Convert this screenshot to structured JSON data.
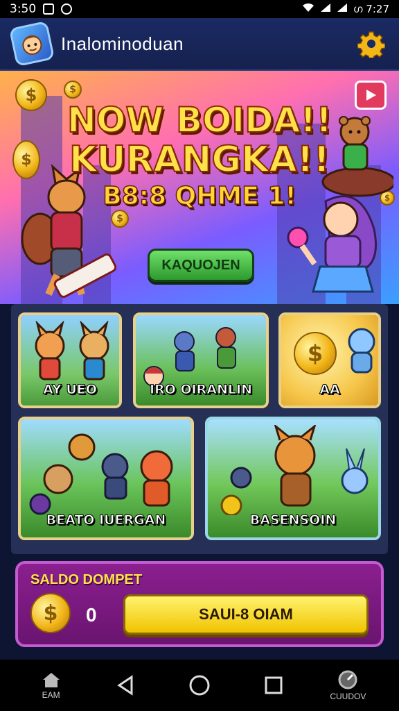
{
  "status_bar": {
    "time": "3:50",
    "right_text": "ഗ 7:27"
  },
  "header": {
    "title": "Inalominoduan",
    "logo_icon": "avatar-logo-icon",
    "settings_icon": "gear-icon",
    "accent": "#f2b619"
  },
  "banner": {
    "headline_line1": "NOW BOIDA!!",
    "headline_line2": "KURANGKA!!",
    "subline": "B8:8 QHME 1!",
    "button_label": "KAQUOJEN",
    "play_icon": "play-icon"
  },
  "cards": [
    {
      "label": "AY UEO"
    },
    {
      "label": "IRO OIRANLIN"
    },
    {
      "label": "AA"
    },
    {
      "label": "BEATO IUERGAN"
    },
    {
      "label": "BASENSOIN"
    }
  ],
  "wallet": {
    "title": "SALDO DOMPET",
    "balance": "0",
    "button_label": "SAUI-8 OIAM",
    "coin_symbol": "$"
  },
  "nav": {
    "home_label": "EAM",
    "back_icon": "back-triangle-icon",
    "home_circle_icon": "home-circle-icon",
    "recents_icon": "recents-square-icon",
    "right_label": "CUUDOV"
  },
  "colors": {
    "header_bg": "#1a2a63",
    "wallet_bg": "#8b1f8f",
    "button_yellow": "#f0c300",
    "button_green": "#2d9a2e"
  }
}
